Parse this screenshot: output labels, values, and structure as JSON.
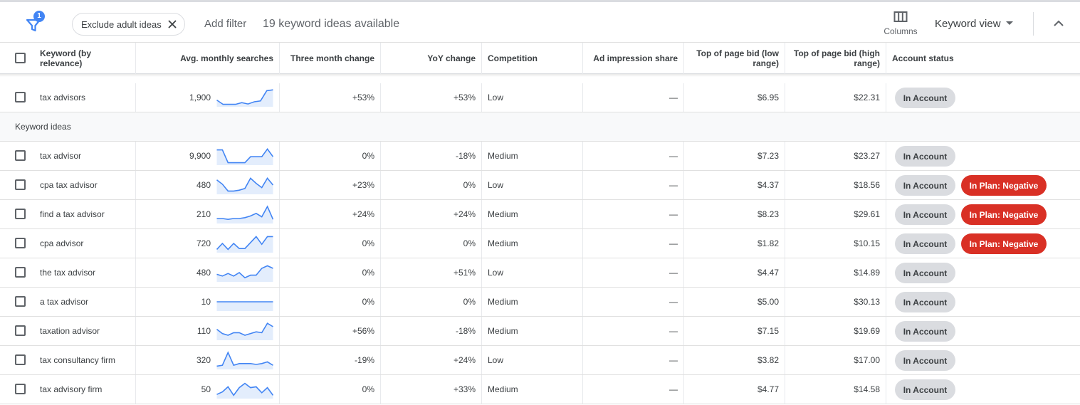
{
  "toolbar": {
    "filter_count": "1",
    "chip_label": "Exclude adult ideas",
    "add_filter": "Add filter",
    "ideas_available": "19 keyword ideas available",
    "columns_label": "Columns",
    "view_label": "Keyword view"
  },
  "headers": {
    "keyword": "Keyword (by relevance)",
    "searches": "Avg. monthly searches",
    "three_month": "Three month change",
    "yoy": "YoY change",
    "competition": "Competition",
    "impression": "Ad impression share",
    "bid_low": "Top of page bid (low range)",
    "bid_high": "Top of page bid (high range)",
    "status": "Account status"
  },
  "section_label": "Keyword ideas",
  "provided": [
    {
      "keyword": "tax advisors",
      "searches": "1,900",
      "three_month": "+53%",
      "yoy": "+53%",
      "competition": "Low",
      "impression": "—",
      "bid_low": "$6.95",
      "bid_high": "$22.31",
      "status": "In Account",
      "plan": "",
      "trend": [
        0.35,
        0.1,
        0.1,
        0.1,
        0.2,
        0.12,
        0.25,
        0.3,
        0.9,
        0.95
      ]
    }
  ],
  "rows": [
    {
      "keyword": "tax advisor",
      "searches": "9,900",
      "three_month": "0%",
      "yoy": "-18%",
      "competition": "Medium",
      "impression": "—",
      "bid_low": "$7.23",
      "bid_high": "$23.27",
      "status": "In Account",
      "plan": "",
      "trend": [
        0.85,
        0.85,
        0.1,
        0.1,
        0.1,
        0.1,
        0.45,
        0.45,
        0.45,
        0.9,
        0.45
      ]
    },
    {
      "keyword": "cpa tax advisor",
      "searches": "480",
      "three_month": "+23%",
      "yoy": "0%",
      "competition": "Low",
      "impression": "—",
      "bid_low": "$4.37",
      "bid_high": "$18.56",
      "status": "In Account",
      "plan": "In Plan: Negative",
      "trend": [
        0.8,
        0.55,
        0.15,
        0.15,
        0.2,
        0.3,
        0.9,
        0.6,
        0.35,
        0.9,
        0.5
      ]
    },
    {
      "keyword": "find a tax advisor",
      "searches": "210",
      "three_month": "+24%",
      "yoy": "+24%",
      "competition": "Medium",
      "impression": "—",
      "bid_low": "$8.23",
      "bid_high": "$29.61",
      "status": "In Account",
      "plan": "In Plan: Negative",
      "trend": [
        0.25,
        0.25,
        0.2,
        0.25,
        0.25,
        0.3,
        0.4,
        0.55,
        0.35,
        0.95,
        0.2
      ]
    },
    {
      "keyword": "cpa advisor",
      "searches": "720",
      "three_month": "0%",
      "yoy": "0%",
      "competition": "Medium",
      "impression": "—",
      "bid_low": "$1.82",
      "bid_high": "$10.15",
      "status": "In Account",
      "plan": "In Plan: Negative",
      "trend": [
        0.15,
        0.5,
        0.15,
        0.5,
        0.2,
        0.2,
        0.55,
        0.9,
        0.45,
        0.9,
        0.9
      ]
    },
    {
      "keyword": "the tax advisor",
      "searches": "480",
      "three_month": "0%",
      "yoy": "+51%",
      "competition": "Low",
      "impression": "—",
      "bid_low": "$4.47",
      "bid_high": "$14.89",
      "status": "In Account",
      "plan": "",
      "trend": [
        0.4,
        0.3,
        0.45,
        0.3,
        0.5,
        0.2,
        0.35,
        0.35,
        0.75,
        0.9,
        0.75
      ]
    },
    {
      "keyword": "a tax advisor",
      "searches": "10",
      "three_month": "0%",
      "yoy": "0%",
      "competition": "Medium",
      "impression": "—",
      "bid_low": "$5.00",
      "bid_high": "$30.13",
      "status": "In Account",
      "plan": "",
      "trend": [
        0.5,
        0.5,
        0.5,
        0.5,
        0.5,
        0.5,
        0.5,
        0.5,
        0.5,
        0.5,
        0.5
      ]
    },
    {
      "keyword": "taxation advisor",
      "searches": "110",
      "three_month": "+56%",
      "yoy": "-18%",
      "competition": "Medium",
      "impression": "—",
      "bid_low": "$7.15",
      "bid_high": "$19.69",
      "status": "In Account",
      "plan": "",
      "trend": [
        0.6,
        0.35,
        0.25,
        0.4,
        0.4,
        0.25,
        0.35,
        0.45,
        0.4,
        0.95,
        0.75
      ]
    },
    {
      "keyword": "tax consultancy firm",
      "searches": "320",
      "three_month": "-19%",
      "yoy": "+24%",
      "competition": "Low",
      "impression": "—",
      "bid_low": "$3.82",
      "bid_high": "$17.00",
      "status": "In Account",
      "plan": "",
      "trend": [
        0.15,
        0.2,
        0.95,
        0.2,
        0.3,
        0.3,
        0.3,
        0.25,
        0.3,
        0.4,
        0.2
      ]
    },
    {
      "keyword": "tax advisory firm",
      "searches": "50",
      "three_month": "0%",
      "yoy": "+33%",
      "competition": "Medium",
      "impression": "—",
      "bid_low": "$4.77",
      "bid_high": "$14.58",
      "status": "In Account",
      "plan": "",
      "trend": [
        0.2,
        0.35,
        0.65,
        0.15,
        0.6,
        0.85,
        0.6,
        0.65,
        0.3,
        0.6,
        0.15
      ]
    }
  ],
  "colors": {
    "accent": "#4285f4",
    "negative": "#d93025",
    "badge": "#dadce0"
  }
}
